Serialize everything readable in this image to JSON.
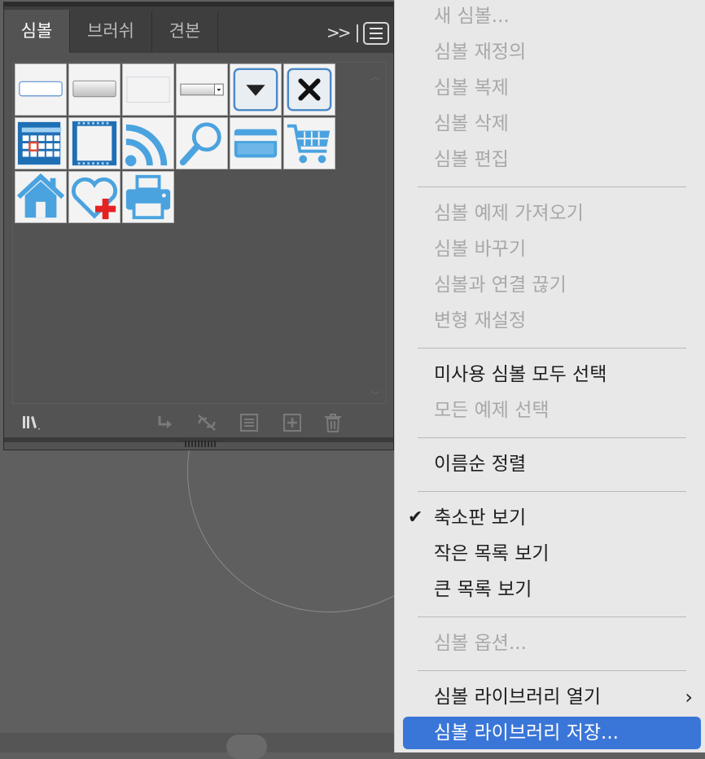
{
  "panel": {
    "tabs": [
      "심볼",
      "브러쉬",
      "견본"
    ],
    "more_glyph": ">>",
    "symbols": [
      {
        "name": "button-flat"
      },
      {
        "name": "button-gradient"
      },
      {
        "name": "button-blank"
      },
      {
        "name": "dropdown-field"
      },
      {
        "name": "dropdown-arrow"
      },
      {
        "name": "close-x"
      },
      {
        "name": "calendar"
      },
      {
        "name": "film-frame"
      },
      {
        "name": "rss"
      },
      {
        "name": "magnifier"
      },
      {
        "name": "credit-card"
      },
      {
        "name": "shopping-cart"
      },
      {
        "name": "home"
      },
      {
        "name": "heart-plus"
      },
      {
        "name": "printer"
      }
    ],
    "footer_icons": [
      "symbol-libraries-icon",
      "place-symbol-icon",
      "break-link-icon",
      "symbol-options-icon",
      "new-symbol-icon",
      "delete-icon"
    ]
  },
  "colors": {
    "menu_highlight": "#3a76d8",
    "symbol_blue": "#4aa3df",
    "panel_bg": "#535353"
  },
  "menu": {
    "items": [
      {
        "label": "새 심볼...",
        "disabled": true
      },
      {
        "label": "심볼 재정의",
        "disabled": true
      },
      {
        "label": "심볼 복제",
        "disabled": true
      },
      {
        "label": "심볼 삭제",
        "disabled": true
      },
      {
        "label": "심볼 편집",
        "disabled": true
      },
      {
        "label": "심볼 예제 가져오기",
        "disabled": true
      },
      {
        "label": "심볼 바꾸기",
        "disabled": true
      },
      {
        "label": "심볼과 연결 끊기",
        "disabled": true
      },
      {
        "label": "변형 재설정",
        "disabled": true
      },
      {
        "label": "미사용 심볼 모두 선택",
        "disabled": false
      },
      {
        "label": "모든 예제 선택",
        "disabled": true
      },
      {
        "label": "이름순 정렬",
        "disabled": false
      },
      {
        "label": "축소판 보기",
        "disabled": false,
        "checked": true
      },
      {
        "label": "작은 목록 보기",
        "disabled": false
      },
      {
        "label": "큰 목록 보기",
        "disabled": false
      },
      {
        "label": "심볼 옵션...",
        "disabled": true
      },
      {
        "label": "심볼 라이브러리 열기",
        "disabled": false,
        "submenu": true
      },
      {
        "label": "심볼 라이브러리 저장...",
        "disabled": false,
        "highlighted": true
      }
    ],
    "check_glyph": "✔",
    "submenu_glyph": "›"
  }
}
